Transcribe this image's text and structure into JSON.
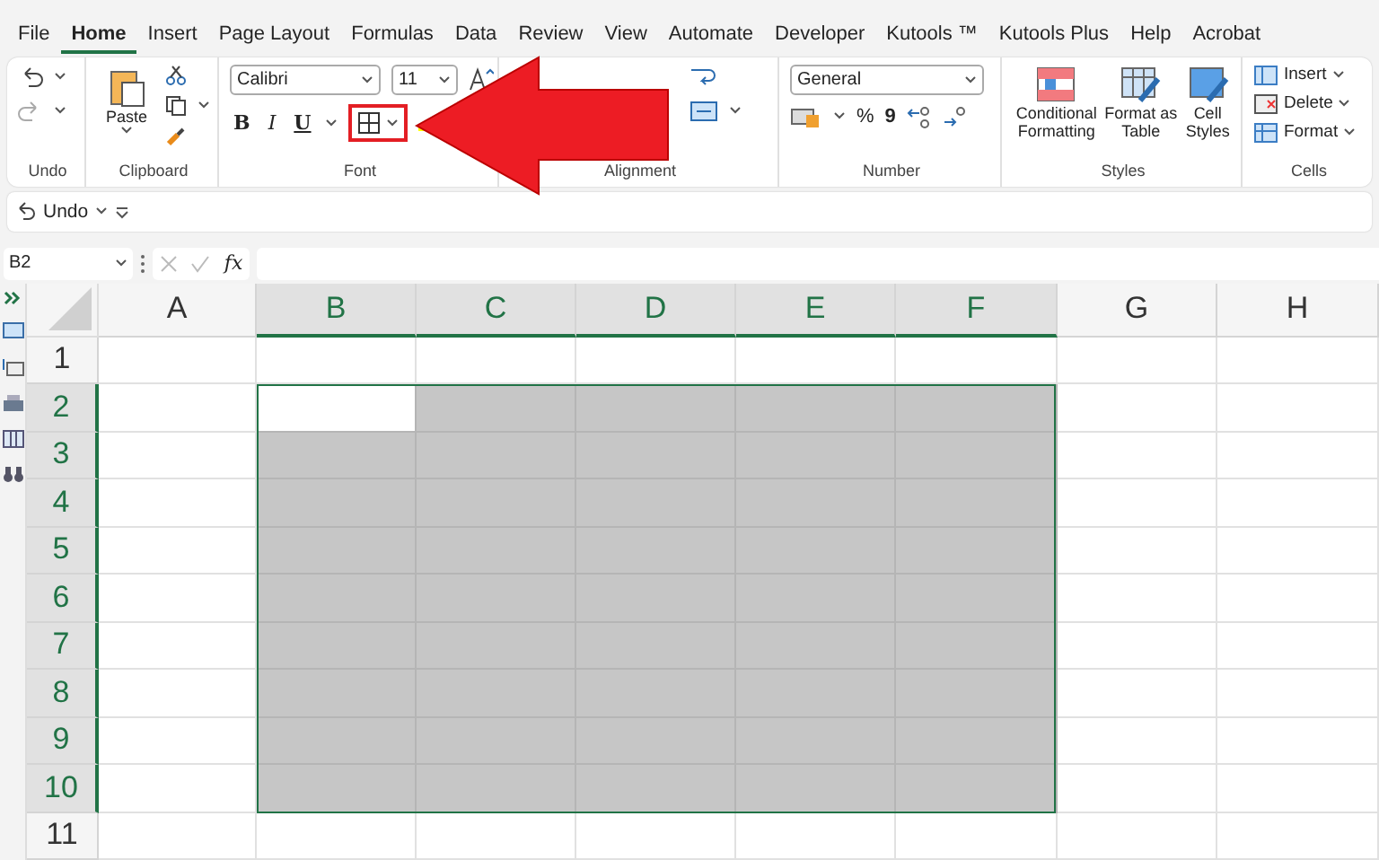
{
  "tabs": [
    {
      "label": "File",
      "selected": false
    },
    {
      "label": "Home",
      "selected": true
    },
    {
      "label": "Insert",
      "selected": false
    },
    {
      "label": "Page Layout",
      "selected": false
    },
    {
      "label": "Formulas",
      "selected": false
    },
    {
      "label": "Data",
      "selected": false
    },
    {
      "label": "Review",
      "selected": false
    },
    {
      "label": "View",
      "selected": false
    },
    {
      "label": "Automate",
      "selected": false
    },
    {
      "label": "Developer",
      "selected": false
    },
    {
      "label": "Kutools ™",
      "selected": false
    },
    {
      "label": "Kutools Plus",
      "selected": false
    },
    {
      "label": "Help",
      "selected": false
    },
    {
      "label": "Acrobat",
      "selected": false
    }
  ],
  "ribbon": {
    "undo_group": {
      "label": "Undo"
    },
    "clipboard": {
      "label": "Clipboard",
      "paste": "Paste"
    },
    "font": {
      "label": "Font",
      "font_name": "Calibri",
      "font_size": "11",
      "bold": "B",
      "italic": "I",
      "underline": "U",
      "borders_highlighted": true
    },
    "alignment": {
      "label": "Alignment"
    },
    "number": {
      "label": "Number",
      "format": "General",
      "percent": "%",
      "comma": "9"
    },
    "styles": {
      "label": "Styles",
      "buttons": [
        {
          "label": "Conditional Formatting",
          "kind": "conditional"
        },
        {
          "label": "Format as Table",
          "kind": "table"
        },
        {
          "label": "Cell Styles",
          "kind": "styles"
        }
      ]
    },
    "cells": {
      "label": "Cells",
      "buttons": [
        {
          "label": "Insert",
          "kind": "insert"
        },
        {
          "label": "Delete",
          "kind": "delete"
        },
        {
          "label": "Format",
          "kind": "format"
        }
      ]
    }
  },
  "quick_access": {
    "undo": "Undo"
  },
  "formula_bar": {
    "name_box": "B2",
    "fx": "fx"
  },
  "annotation": {
    "kind": "arrow"
  },
  "columns": [
    {
      "label": "A",
      "selected": false,
      "active": false
    },
    {
      "label": "B",
      "selected": true,
      "active": true
    },
    {
      "label": "C",
      "selected": true,
      "active": false
    },
    {
      "label": "D",
      "selected": true,
      "active": false
    },
    {
      "label": "E",
      "selected": true,
      "active": false
    },
    {
      "label": "F",
      "selected": true,
      "active": false
    },
    {
      "label": "G",
      "selected": false,
      "active": false
    },
    {
      "label": "H",
      "selected": false,
      "active": false
    }
  ],
  "rows": [
    {
      "label": "1",
      "selected": false,
      "active": false
    },
    {
      "label": "2",
      "selected": true,
      "active": true
    },
    {
      "label": "3",
      "selected": true,
      "active": false
    },
    {
      "label": "4",
      "selected": true,
      "active": false
    },
    {
      "label": "5",
      "selected": true,
      "active": false
    },
    {
      "label": "6",
      "selected": true,
      "active": false
    },
    {
      "label": "7",
      "selected": true,
      "active": false
    },
    {
      "label": "8",
      "selected": true,
      "active": false
    },
    {
      "label": "9",
      "selected": true,
      "active": false
    },
    {
      "label": "10",
      "selected": true,
      "active": false
    },
    {
      "label": "11",
      "selected": false,
      "active": false
    }
  ]
}
